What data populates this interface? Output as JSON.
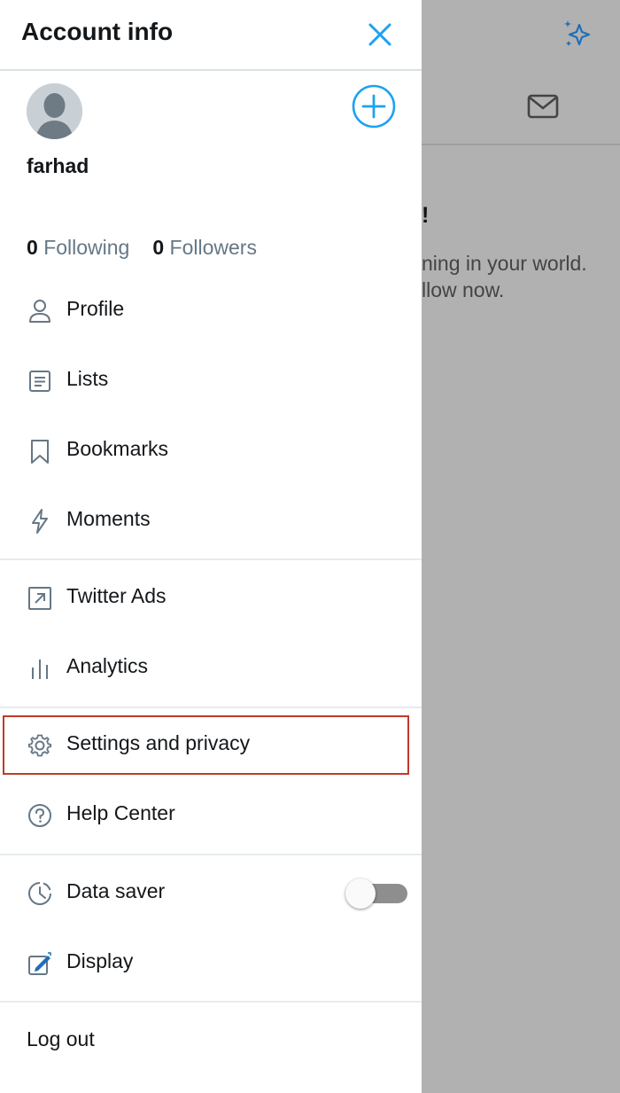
{
  "drawer": {
    "title": "Account info",
    "username": "farhad",
    "following_count": "0",
    "following_label": "Following",
    "followers_count": "0",
    "followers_label": "Followers"
  },
  "menu": {
    "profile": "Profile",
    "lists": "Lists",
    "bookmarks": "Bookmarks",
    "moments": "Moments",
    "twitter_ads": "Twitter Ads",
    "analytics": "Analytics",
    "settings": "Settings and privacy",
    "help": "Help Center",
    "data_saver": "Data saver",
    "display": "Display",
    "logout": "Log out"
  },
  "data_saver_enabled": false,
  "background": {
    "heading_fragment": "!",
    "line1_fragment": "ning in your world.",
    "line2_fragment": "llow now."
  },
  "colors": {
    "accent": "#1da1f2",
    "highlight_border": "#c0392b"
  }
}
